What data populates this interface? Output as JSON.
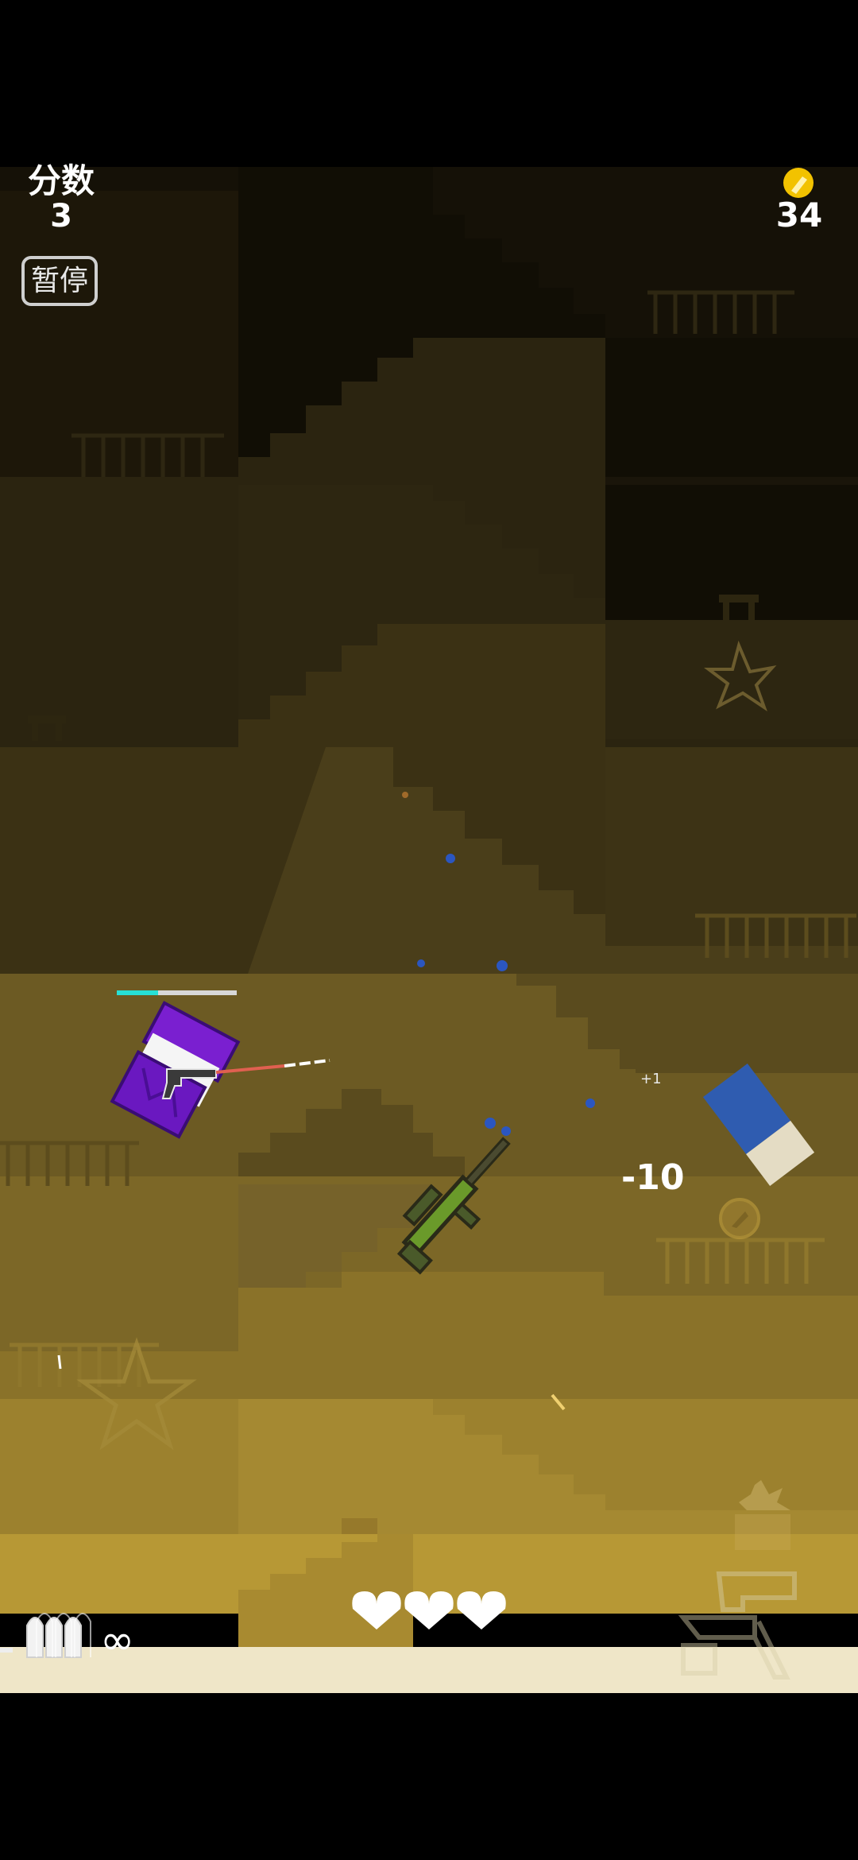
{
  "hud": {
    "score_label": "分数",
    "score_value": "3",
    "pause_label": "暂停",
    "coin_count": "34",
    "ammo_count": "∞",
    "hearts": 3
  },
  "popups": {
    "damage": "-10",
    "bonus": "+1"
  },
  "icons": {
    "coin": "gold-coin-icon",
    "heart": "heart-icon",
    "ammo": "bullets-icon",
    "player_weapon": "revolver-icon",
    "dropped_weapon": "sniper-rifle-icon"
  },
  "colors": {
    "background_top": "#0c0a04",
    "coin": "#f2c200",
    "player": "#7a1fd0",
    "health_bar": "#27e0d6",
    "enemy_block": "#2f5cb0",
    "floor": "#efe6c8"
  }
}
